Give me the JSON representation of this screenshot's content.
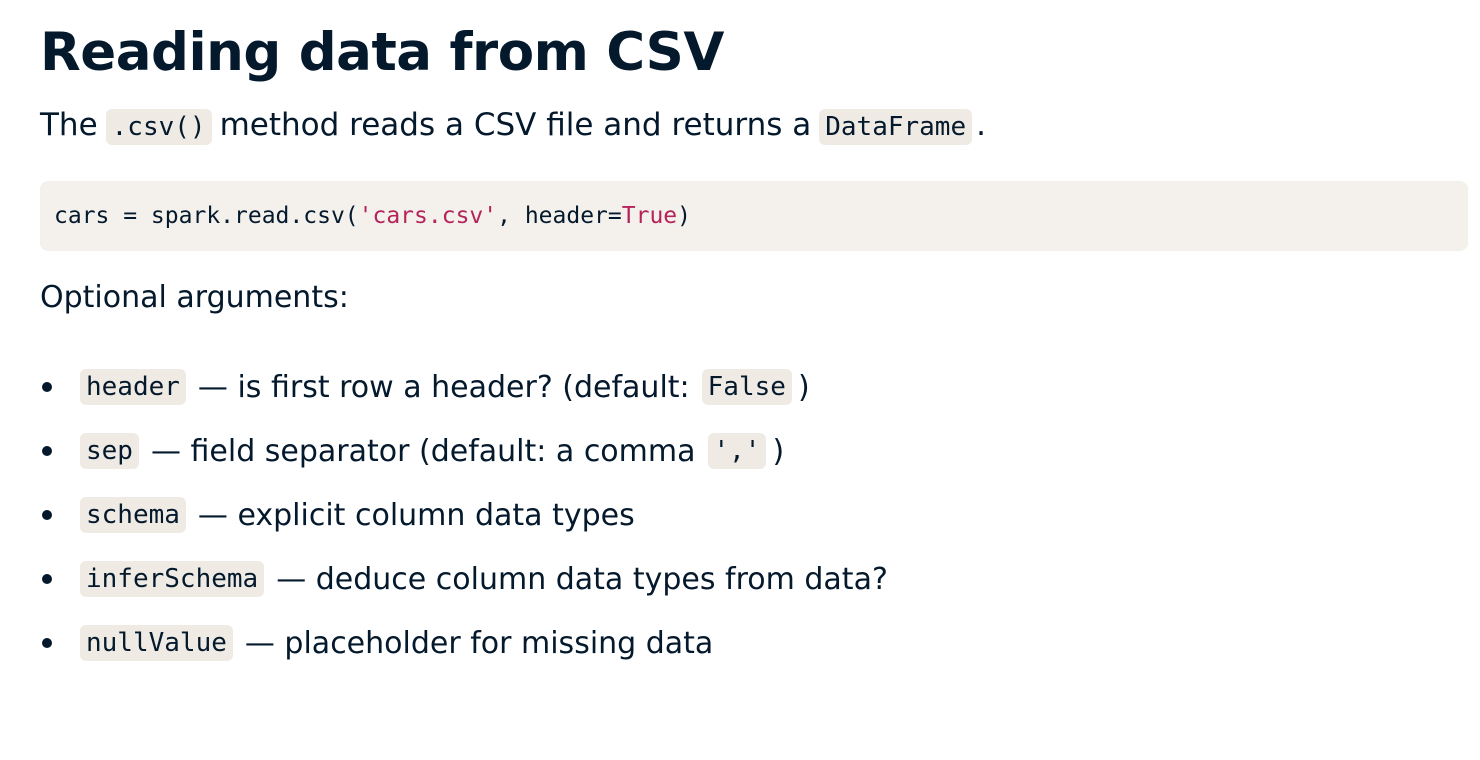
{
  "title": "Reading data from CSV",
  "intro": {
    "prefix": "The",
    "method": ".csv()",
    "middle": "method reads a CSV file and returns a",
    "type": "DataFrame",
    "suffix": "."
  },
  "code": {
    "part1": "cars = spark.read.csv(",
    "string": "'cars.csv'",
    "part2": ", header=",
    "keyword": "True",
    "part3": ")"
  },
  "subheading": "Optional arguments:",
  "arguments": [
    {
      "name": "header",
      "desc": "— is first row a header? (default:",
      "default": "False",
      "tail": ")"
    },
    {
      "name": "sep",
      "desc": "— field separator (default: a comma",
      "default": "','",
      "tail": ")"
    },
    {
      "name": "schema",
      "desc": "— explicit column data types"
    },
    {
      "name": "inferSchema",
      "desc": "— deduce column data types from data?"
    },
    {
      "name": "nullValue",
      "desc": "— placeholder for missing data"
    }
  ],
  "colors": {
    "text": "#05192d",
    "inline_code_bg": "#efebe4",
    "code_block_bg": "#f4f1ec",
    "code_literal": "#b4235a"
  }
}
